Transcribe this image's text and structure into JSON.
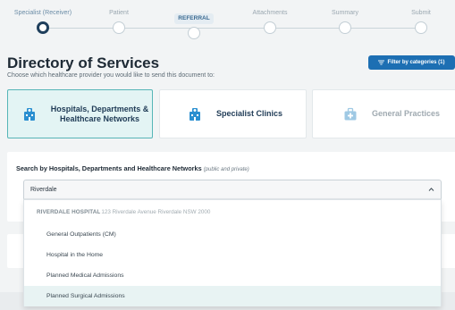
{
  "stepper": {
    "steps": [
      {
        "label": "Specialist (Receiver)"
      },
      {
        "label": "Patient"
      },
      {
        "label": "REFERRAL"
      },
      {
        "label": "Attachments"
      },
      {
        "label": "Summary"
      },
      {
        "label": "Submit"
      }
    ],
    "current_index": 0
  },
  "header": {
    "title": "Directory of Services",
    "subtitle": "Choose which healthcare provider you would like to send this document to:",
    "filter_button": "Filter by categories (1)"
  },
  "categories": [
    {
      "label": "Hospitals, Departments & Healthcare Networks",
      "selected": true,
      "icon": "hospital-building-icon"
    },
    {
      "label": "Specialist Clinics",
      "selected": false,
      "icon": "clinic-building-icon"
    },
    {
      "label": "General Practices",
      "selected": false,
      "disabled": true,
      "icon": "medical-bag-icon"
    }
  ],
  "search": {
    "title": "Search by Hospitals, Departments and Healthcare Networks",
    "note": "(public and private)",
    "value": "Riverdale"
  },
  "dropdown": {
    "group_name": "RIVERDALE HOSPITAL",
    "group_address": "123 Riverdale Avenue Riverdale NSW 2000",
    "items": [
      {
        "label": "General Outpatients (CM)"
      },
      {
        "label": "Hospital in the Home"
      },
      {
        "label": "Planned Medical Admissions"
      },
      {
        "label": "Planned Surgical Admissions"
      }
    ],
    "hover_index": 3
  },
  "colors": {
    "primary": "#1d6fb3",
    "selected_tile_bg": "#e3f4f4",
    "selected_tile_border": "#56b5b7",
    "stepper_current": "#1f3f5c"
  }
}
